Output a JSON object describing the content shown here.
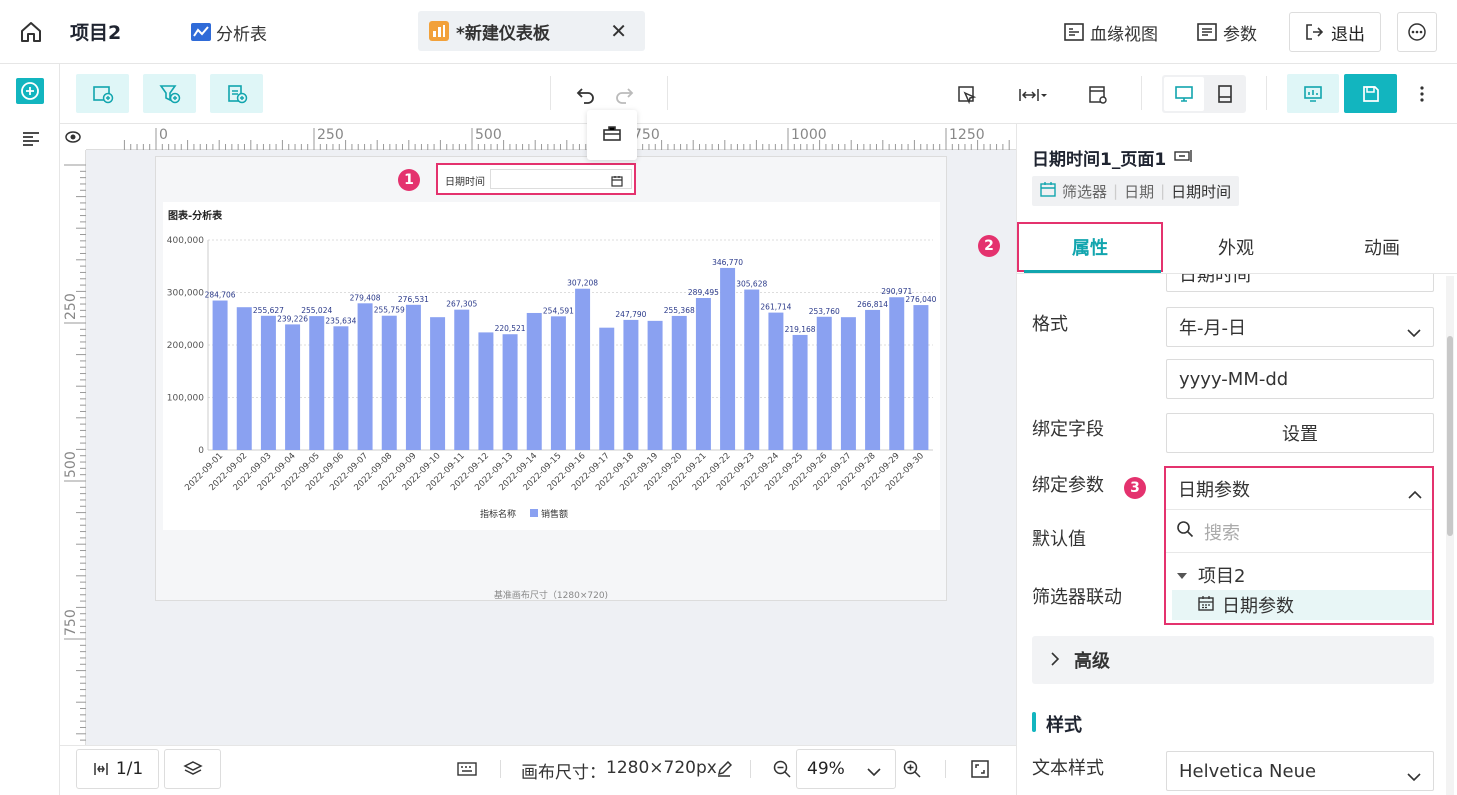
{
  "topbar": {
    "project_title": "项目2",
    "tab_analysis": "分析表",
    "tab_dashboard": "*新建仪表板",
    "lineage_view": "血缘视图",
    "params": "参数",
    "exit": "退出"
  },
  "canvas": {
    "ruler_top": [
      "0",
      "250",
      "500",
      "750",
      "1000",
      "1250"
    ],
    "ruler_left": [
      "250",
      "500",
      "750"
    ],
    "filter_label": "日期时间",
    "base_size_note": "基准画布尺寸（1280×720)"
  },
  "chart_data": {
    "type": "bar",
    "title": "图表-分析表",
    "legend_title": "指标名称",
    "legend": [
      "销售额"
    ],
    "color": "#8aa1f1",
    "ylim": [
      0,
      400000
    ],
    "yticks": [
      "0",
      "100,000",
      "200,000",
      "300,000",
      "400,000"
    ],
    "categories": [
      "2022-09-01",
      "2022-09-02",
      "2022-09-03",
      "2022-09-04",
      "2022-09-05",
      "2022-09-06",
      "2022-09-07",
      "2022-09-08",
      "2022-09-09",
      "2022-09-10",
      "2022-09-11",
      "2022-09-12",
      "2022-09-13",
      "2022-09-14",
      "2022-09-15",
      "2022-09-16",
      "2022-09-17",
      "2022-09-18",
      "2022-09-19",
      "2022-09-20",
      "2022-09-21",
      "2022-09-22",
      "2022-09-23",
      "2022-09-24",
      "2022-09-25",
      "2022-09-26",
      "2022-09-27",
      "2022-09-28",
      "2022-09-29",
      "2022-09-30"
    ],
    "values": [
      284706,
      272000,
      255627,
      239226,
      255024,
      235634,
      279408,
      255759,
      276531,
      253000,
      267305,
      224000,
      220521,
      261000,
      254591,
      307208,
      233000,
      247790,
      246000,
      255368,
      289495,
      346770,
      305628,
      261714,
      219168,
      253760,
      253000,
      266814,
      290971,
      276040
    ],
    "labels": [
      "284,706",
      "",
      "255,627",
      "239,226",
      "255,024",
      "235,634",
      "279,408",
      "255,759",
      "276,531",
      "",
      "267,305",
      "",
      "220,521",
      "",
      "254,591",
      "307,208",
      "",
      "247,790",
      "",
      "255,368",
      "289,495",
      "346,770",
      "305,628",
      "261,714",
      "219,168",
      "253,760",
      "",
      "266,814",
      "290,971",
      "276,040"
    ]
  },
  "bottom": {
    "pages": "1/1",
    "canvas_size_label": "画布尺寸：",
    "canvas_size": "1280×720px",
    "zoom": "49%"
  },
  "panel": {
    "component_name": "日期时间1_页面1",
    "crumb": [
      "筛选器",
      "日期",
      "日期时间"
    ],
    "tabs": [
      "属性",
      "外观",
      "动画"
    ],
    "partial_value": "日期时间",
    "format_label": "格式",
    "format_value": "年-月-日",
    "format_pattern": "yyyy-MM-dd",
    "bind_field_label": "绑定字段",
    "bind_field_btn": "设置",
    "bind_param_label": "绑定参数",
    "bind_param_value": "日期参数",
    "default_label": "默认值",
    "linkage_label": "筛选器联动",
    "search_placeholder": "搜索",
    "tree_group": "项目2",
    "tree_item": "日期参数",
    "advanced": "高级",
    "style_section": "样式",
    "text_style_label": "文本样式",
    "text_style_value": "Helvetica Neue"
  },
  "annotations": [
    "1",
    "2",
    "3"
  ]
}
